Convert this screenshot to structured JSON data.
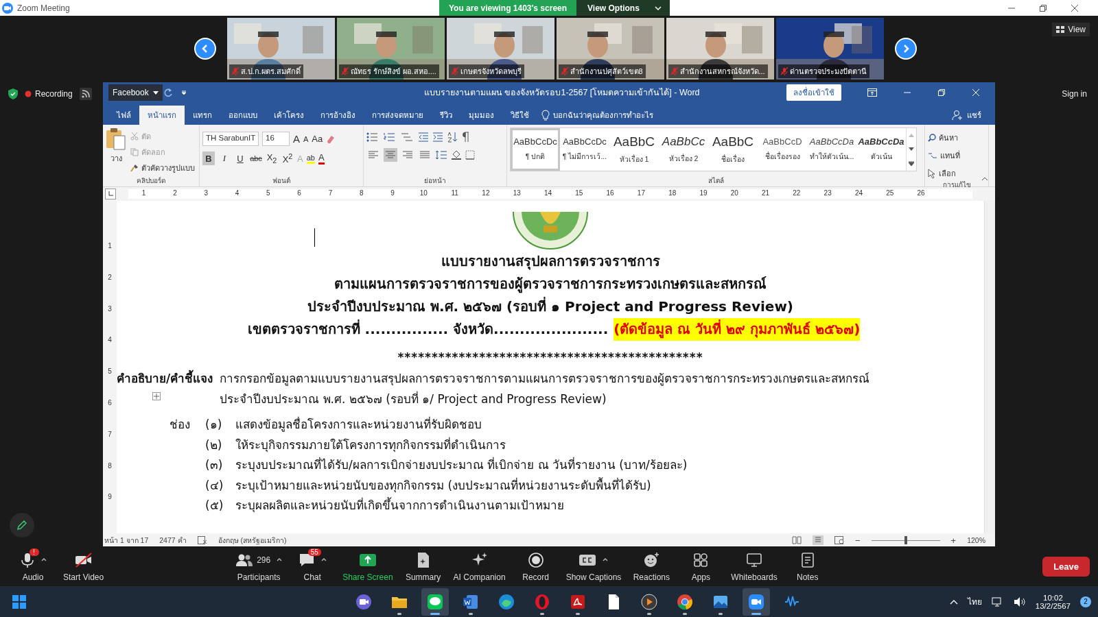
{
  "zoom_window": {
    "title": "Zoom Meeting"
  },
  "share_banner": {
    "text": "You are viewing 1403's screen",
    "button": "View Options"
  },
  "gallery": {
    "view_button": "View",
    "tiles": [
      {
        "name": "ส.ป.ก.ผตร.สมศักดิ์",
        "muted": true
      },
      {
        "name": "ณัทธร รักษ์สิงข์ ผอ.สหอ....",
        "muted": true
      },
      {
        "name": "เกษตรจังหวัดลพบุรี",
        "muted": true
      },
      {
        "name": "สำนักงานปศุสัตว์เขต8",
        "muted": true
      },
      {
        "name": "สำนักงานสหกรณ์จังหวัด...",
        "muted": true
      },
      {
        "name": "ด่านตรวจประมงปัตตานี",
        "muted": true
      }
    ]
  },
  "recording": {
    "label": "Recording"
  },
  "sign_in": "Sign in",
  "word": {
    "quick_access_menu": "Facebook",
    "title": "แบบรายงานตามแผน ของจังหวัดรอบ1-2567  [โหมดความเข้ากันได้]  -  Word",
    "sign_in_button": "ลงชื่อเข้าใช้",
    "tabs": [
      {
        "label": "ไฟล์",
        "selected": false
      },
      {
        "label": "หน้าแรก",
        "selected": true
      },
      {
        "label": "แทรก",
        "selected": false
      },
      {
        "label": "ออกแบบ",
        "selected": false
      },
      {
        "label": "เค้าโครง",
        "selected": false
      },
      {
        "label": "การอ้างอิง",
        "selected": false
      },
      {
        "label": "การส่งจดหมาย",
        "selected": false
      },
      {
        "label": "รีวิว",
        "selected": false
      },
      {
        "label": "มุมมอง",
        "selected": false
      },
      {
        "label": "วิธีใช้",
        "selected": false
      }
    ],
    "tell_me": "บอกฉันว่าคุณต้องการทำอะไร",
    "share": "แชร์",
    "ribbon": {
      "clipboard": {
        "paste": "วาง",
        "cut": "ตัด",
        "copy": "คัดลอก",
        "format_painter": "ตัวคัดวางรูปแบบ",
        "group": "คลิปบอร์ด"
      },
      "font": {
        "name": "TH SarabunIT",
        "size": "16",
        "grow": "A",
        "shrink": "A",
        "change_case": "Aa",
        "effects": "A",
        "highlight": "ab",
        "font_color": "A",
        "group": "ฟอนต์",
        "buttons": [
          {
            "label": "B",
            "kind": "bold",
            "selected": true
          },
          {
            "label": "I",
            "kind": "italic",
            "selected": false
          },
          {
            "label": "U",
            "kind": "underline",
            "selected": false
          },
          {
            "label": "abc",
            "kind": "strike",
            "selected": false
          },
          {
            "label": "X$_{2}$",
            "kind": "plain",
            "selected": false
          },
          {
            "label": "X$^{2}$",
            "kind": "plain",
            "selected": false
          }
        ]
      },
      "paragraph": {
        "group": "ย่อหน้า",
        "align_buttons": [
          {
            "selected": false
          },
          {
            "selected": true
          },
          {
            "selected": false
          },
          {
            "selected": false
          }
        ]
      },
      "styles": {
        "group": "สไตล์",
        "items": [
          {
            "preview": "AaBbCcDc",
            "label": "¶ ปกติ",
            "kind": "normal",
            "selected": true
          },
          {
            "preview": "AaBbCcDc",
            "label": "¶ ไม่มีการเว้...",
            "kind": "normal",
            "selected": false
          },
          {
            "preview": "AaBbC",
            "label": "หัวเรื่อง 1",
            "kind": "heading",
            "selected": false
          },
          {
            "preview": "AaBbCc",
            "label": "หัวเรื่อง 2",
            "kind": "italic-heading",
            "selected": false
          },
          {
            "preview": "AaBbC",
            "label": "ชื่อเรื่อง",
            "kind": "title",
            "selected": false
          },
          {
            "preview": "AaBbCcD",
            "label": "ชื่อเรื่องรอง",
            "kind": "subtitle",
            "selected": false
          },
          {
            "preview": "AaBbCcDa",
            "label": "ทำให้ตัวเน้น...",
            "kind": "italic",
            "selected": false
          },
          {
            "preview": "AaBbCcDa",
            "label": "ตัวเน้น",
            "kind": "bold-italic",
            "selected": false
          }
        ]
      },
      "editing": {
        "group": "การแก้ไข",
        "find": "ค้นหา",
        "replace": "แทนที่",
        "select": "เลือก"
      }
    },
    "ruler": {
      "marks": [
        "1",
        "2",
        "3",
        "4",
        "5",
        "6",
        "7",
        "8",
        "9",
        "10",
        "11",
        "12",
        "13",
        "14",
        "15",
        "16",
        "17",
        "18",
        "19",
        "20",
        "21",
        "22",
        "23",
        "24",
        "25",
        "26"
      ],
      "side_marks": [
        "1",
        "2",
        "3",
        "4",
        "5",
        "6",
        "7",
        "8",
        "9"
      ]
    },
    "document": {
      "title_lines": [
        "แบบรายงานสรุปผลการตรวจราชการ",
        "ตามแผนการตรวจราชการของผู้ตรวจราชการกระทรวงเกษตรและสหกรณ์",
        "ประจำปีงบประมาณ พ.ศ. ๒๕๖๗ (รอบที่ ๑ Project and Progress Review)"
      ],
      "district_line": "เขตตรวจราชการที่ ................  จังหวัด......................",
      "cutoff_note": "(ตัดข้อมูล ณ วันที่ ๒๙ กุมภาพันธ์ ๒๕๖๗)",
      "separator": "*********************************************",
      "instruction_label": "คำอธิบาย/คำชี้แจง",
      "instruction_text": "การกรอกข้อมูลตามแบบรายงานสรุปผลการตรวจราชการตามแผนการตรวจราชการของผู้ตรวจราชการกระทรวงเกษตรและสหกรณ์ ประจำปีงบประมาณ พ.ศ. ๒๕๖๗ (รอบที่ ๑/ Project and Progress Review)",
      "columns_label": "ช่อง",
      "column_notes": [
        {
          "number": "(๑)",
          "text": "แสดงข้อมูลชื่อโครงการและหน่วยงานที่รับผิดชอบ"
        },
        {
          "number": "(๒)",
          "text": "ให้ระบุกิจกรรมภายใต้โครงการทุกกิจกรรมที่ดำเนินการ"
        },
        {
          "number": "(๓)",
          "text": "ระบุงบประมาณที่ได้รับ/ผลการเบิกจ่ายงบประมาณ ที่เบิกจ่าย ณ วันที่รายงาน (บาท/ร้อยละ)"
        },
        {
          "number": "(๔)",
          "text": "ระบุเป้าหมายและหน่วยนับของทุกกิจกรรม (งบประมาณที่หน่วยงานระดับพื้นที่ได้รับ)"
        },
        {
          "number": "(๕)",
          "text": "ระบุผลผลิตและหน่วยนับที่เกิดขึ้นจากการดำเนินงานตามเป้าหมาย"
        }
      ]
    },
    "status_bar": {
      "page": "หน้า 1 จาก 17",
      "words": "2477 คำ",
      "language": "อังกฤษ (สหรัฐอเมริกา)",
      "zoom": "120%",
      "zoom_out": "−",
      "zoom_in": "+",
      "zoom_slider": {
        "level": 0.5
      }
    }
  },
  "meeting_controls": [
    {
      "label": "Audio",
      "kind": "audio",
      "badge": "!",
      "menu": true,
      "off": false
    },
    {
      "label": "Start Video",
      "kind": "video",
      "menu": false,
      "off": true
    },
    {
      "label": "Participants",
      "kind": "participants",
      "count": "296",
      "menu": true
    },
    {
      "label": "Chat",
      "kind": "chat",
      "badge": "55",
      "menu": true
    },
    {
      "label": "Share Screen",
      "kind": "share",
      "menu": false
    },
    {
      "label": "Summary",
      "kind": "summary",
      "menu": false
    },
    {
      "label": "AI Companion",
      "kind": "ai",
      "menu": false
    },
    {
      "label": "Record",
      "kind": "record",
      "menu": false
    },
    {
      "label": "Show Captions",
      "kind": "captions",
      "menu": true
    },
    {
      "label": "Reactions",
      "kind": "reactions",
      "menu": false
    },
    {
      "label": "Apps",
      "kind": "apps",
      "menu": false
    },
    {
      "label": "Whiteboards",
      "kind": "whiteboard",
      "menu": false
    },
    {
      "label": "Notes",
      "kind": "notes",
      "menu": false
    }
  ],
  "leave_button": "Leave",
  "taskbar": {
    "apps": [
      {
        "kind": "start",
        "running": false,
        "active": false
      },
      {
        "kind": "meet",
        "running": false,
        "active": false
      },
      {
        "kind": "files",
        "running": true,
        "active": false
      },
      {
        "kind": "line",
        "running": true,
        "active": true
      },
      {
        "kind": "word",
        "running": true,
        "active": false
      },
      {
        "kind": "edge",
        "running": false,
        "active": false
      },
      {
        "kind": "opera",
        "running": true,
        "active": false
      },
      {
        "kind": "acrobat",
        "running": true,
        "active": false
      },
      {
        "kind": "file",
        "running": false,
        "active": false
      },
      {
        "kind": "media",
        "running": true,
        "active": false
      },
      {
        "kind": "chrome",
        "running": true,
        "active": false
      },
      {
        "kind": "photos",
        "running": true,
        "active": false
      },
      {
        "kind": "zoom",
        "running": true,
        "active": true
      },
      {
        "kind": "audio",
        "running": false,
        "active": false
      }
    ],
    "language": "ไทย",
    "time": "10:02",
    "date": "13/2/2567",
    "notifications": "2"
  }
}
